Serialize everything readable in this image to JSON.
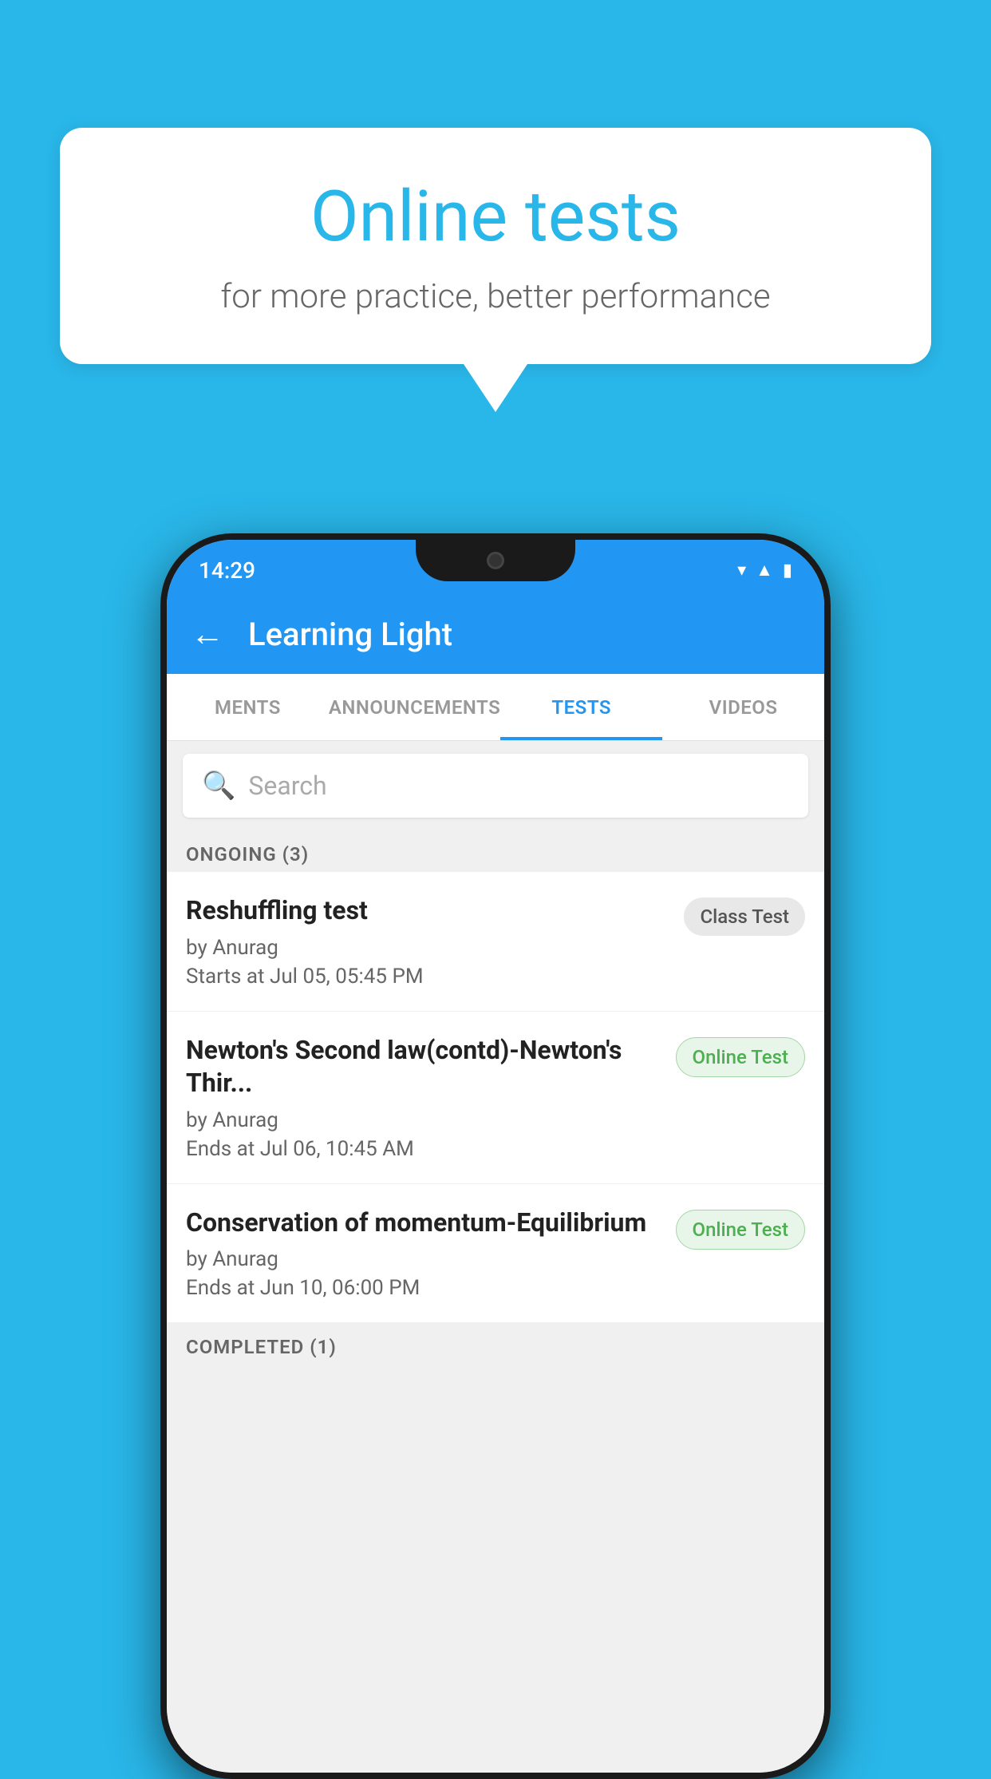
{
  "background_color": "#29b6e8",
  "speech_bubble": {
    "title": "Online tests",
    "subtitle": "for more practice, better performance"
  },
  "status_bar": {
    "time": "14:29",
    "icons": [
      "wifi",
      "signal",
      "battery"
    ]
  },
  "app_bar": {
    "title": "Learning Light",
    "back_label": "←"
  },
  "tabs": [
    {
      "label": "MENTS",
      "active": false
    },
    {
      "label": "ANNOUNCEMENTS",
      "active": false
    },
    {
      "label": "TESTS",
      "active": true
    },
    {
      "label": "VIDEOS",
      "active": false
    }
  ],
  "search": {
    "placeholder": "Search"
  },
  "ongoing_section": {
    "label": "ONGOING (3)"
  },
  "tests": [
    {
      "name": "Reshuffling test",
      "author": "by Anurag",
      "date": "Starts at  Jul 05, 05:45 PM",
      "badge": "Class Test",
      "badge_type": "class"
    },
    {
      "name": "Newton's Second law(contd)-Newton's Thir...",
      "author": "by Anurag",
      "date": "Ends at  Jul 06, 10:45 AM",
      "badge": "Online Test",
      "badge_type": "online"
    },
    {
      "name": "Conservation of momentum-Equilibrium",
      "author": "by Anurag",
      "date": "Ends at  Jun 10, 06:00 PM",
      "badge": "Online Test",
      "badge_type": "online"
    }
  ],
  "completed_section": {
    "label": "COMPLETED (1)"
  }
}
